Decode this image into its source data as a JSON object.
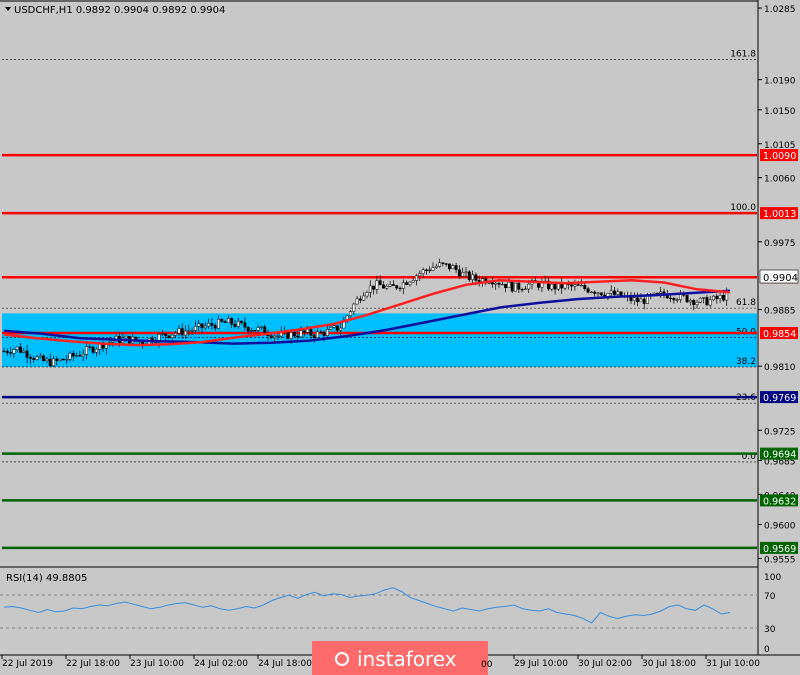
{
  "header": {
    "symbol_line": "USDCHF,H1  0.9892 0.9904 0.9892 0.9904",
    "menu_arrow": "triangle-down-icon"
  },
  "rsi": {
    "label": "RSI(14) 49.8805",
    "levels": [
      "100",
      "70",
      "30",
      "0"
    ]
  },
  "watermark": "instaforex",
  "colors": {
    "background": "#c8c8c8",
    "fib_zone": "#00bfff",
    "resistance": "#ff0000",
    "pivot": "#000080",
    "support": "#006400",
    "ma_fast": "#ff2020",
    "ma_slow": "#1010a0",
    "rsi_line": "#3a8fe0",
    "watermark_bg": "#ff6b6b"
  },
  "chart_data": {
    "type": "candlestick",
    "symbol": "USDCHF",
    "timeframe": "H1",
    "ohlc_last": {
      "open": 0.9892,
      "high": 0.9904,
      "low": 0.9892,
      "close": 0.9904
    },
    "y_range": [
      0.9545,
      1.0293
    ],
    "y_ticks": [
      "1.0285",
      "1.0190",
      "1.0150",
      "1.0105",
      "1.0060",
      "0.9975",
      "0.9885",
      "0.9810",
      "0.9725",
      "0.9685",
      "0.9640",
      "0.9600",
      "0.9555"
    ],
    "x_labels": [
      "22 Jul 2019",
      "22 Jul 18:00",
      "23 Jul 10:00",
      "24 Jul 02:00",
      "24 Jul 18:00",
      "29 Jul 10:00",
      "30 Jul 02:00",
      "30 Jul 18:00",
      "31 Jul 10:00"
    ],
    "hidden_x_label_fragment": "00",
    "current_price": "0.9904",
    "level_lines": [
      {
        "value": 1.009,
        "label": "1.0090",
        "kind": "resistance"
      },
      {
        "value": 1.0013,
        "label": "1.0013",
        "kind": "resistance"
      },
      {
        "value": 0.9928,
        "label": "0.9928",
        "kind": "resistance"
      },
      {
        "value": 0.9854,
        "label": "0.9854",
        "kind": "resistance"
      },
      {
        "value": 0.9769,
        "label": "0.9769",
        "kind": "pivot"
      },
      {
        "value": 0.9694,
        "label": "0.9694",
        "kind": "support"
      },
      {
        "value": 0.9632,
        "label": "0.9632",
        "kind": "support"
      },
      {
        "value": 0.9569,
        "label": "0.9569",
        "kind": "support"
      }
    ],
    "fib_levels": [
      {
        "label": "161.8",
        "value": 1.0217
      },
      {
        "label": "100.0",
        "value": 1.0013
      },
      {
        "label": "61.8",
        "value": 0.9887
      },
      {
        "label": "50.0",
        "value": 0.9848
      },
      {
        "label": "38.2",
        "value": 0.9809
      },
      {
        "label": "23.6",
        "value": 0.9761
      },
      {
        "label": "0.0",
        "value": 0.9683
      }
    ],
    "fib_zone": [
      0.9809,
      0.988
    ],
    "close_path": [
      0.983,
      0.9834,
      0.9826,
      0.9817,
      0.9815,
      0.982,
      0.9826,
      0.9833,
      0.984,
      0.9845,
      0.9846,
      0.9842,
      0.9847,
      0.9852,
      0.9855,
      0.9858,
      0.9862,
      0.9866,
      0.9868,
      0.9864,
      0.986,
      0.9856,
      0.985,
      0.9852,
      0.9854,
      0.9852,
      0.9856,
      0.9862,
      0.989,
      0.9912,
      0.9918,
      0.9913,
      0.992,
      0.993,
      0.9939,
      0.9944,
      0.9941,
      0.993,
      0.9924,
      0.9926,
      0.992,
      0.9914,
      0.9918,
      0.9919,
      0.9915,
      0.9916,
      0.9915,
      0.9912,
      0.9908,
      0.9905,
      0.99,
      0.9896,
      0.9901,
      0.9906,
      0.9903,
      0.9899,
      0.9895,
      0.9898,
      0.9904
    ],
    "ma_fast": [
      0.9852,
      0.9847,
      0.9843,
      0.984,
      0.9838,
      0.9839,
      0.9842,
      0.9848,
      0.9853,
      0.9859,
      0.9866,
      0.9878,
      0.9892,
      0.9906,
      0.9918,
      0.9924,
      0.9922,
      0.992,
      0.9922,
      0.9924,
      0.9921,
      0.9912,
      0.9908
    ],
    "ma_slow": [
      0.9857,
      0.9853,
      0.9847,
      0.9845,
      0.9843,
      0.9842,
      0.984,
      0.9841,
      0.9844,
      0.985,
      0.9858,
      0.9868,
      0.9878,
      0.9888,
      0.9894,
      0.9899,
      0.9902,
      0.9904,
      0.9907,
      0.991
    ],
    "rsi_values": [
      57,
      58,
      56,
      53,
      50,
      54,
      51,
      52,
      56,
      55,
      58,
      60,
      59,
      62,
      64,
      61,
      58,
      55,
      57,
      60,
      62,
      63,
      60,
      57,
      59,
      55,
      53,
      55,
      58,
      56,
      60,
      66,
      70,
      73,
      69,
      74,
      77,
      72,
      75,
      74,
      70,
      72,
      73,
      75,
      80,
      83,
      78,
      70,
      66,
      62,
      58,
      55,
      52,
      56,
      54,
      52,
      55,
      57,
      58,
      60,
      55,
      53,
      52,
      55,
      50,
      48,
      46,
      42,
      36,
      50,
      45,
      42,
      45,
      47,
      46,
      48,
      52,
      58,
      60,
      55,
      53,
      60,
      55,
      48,
      50
    ]
  }
}
